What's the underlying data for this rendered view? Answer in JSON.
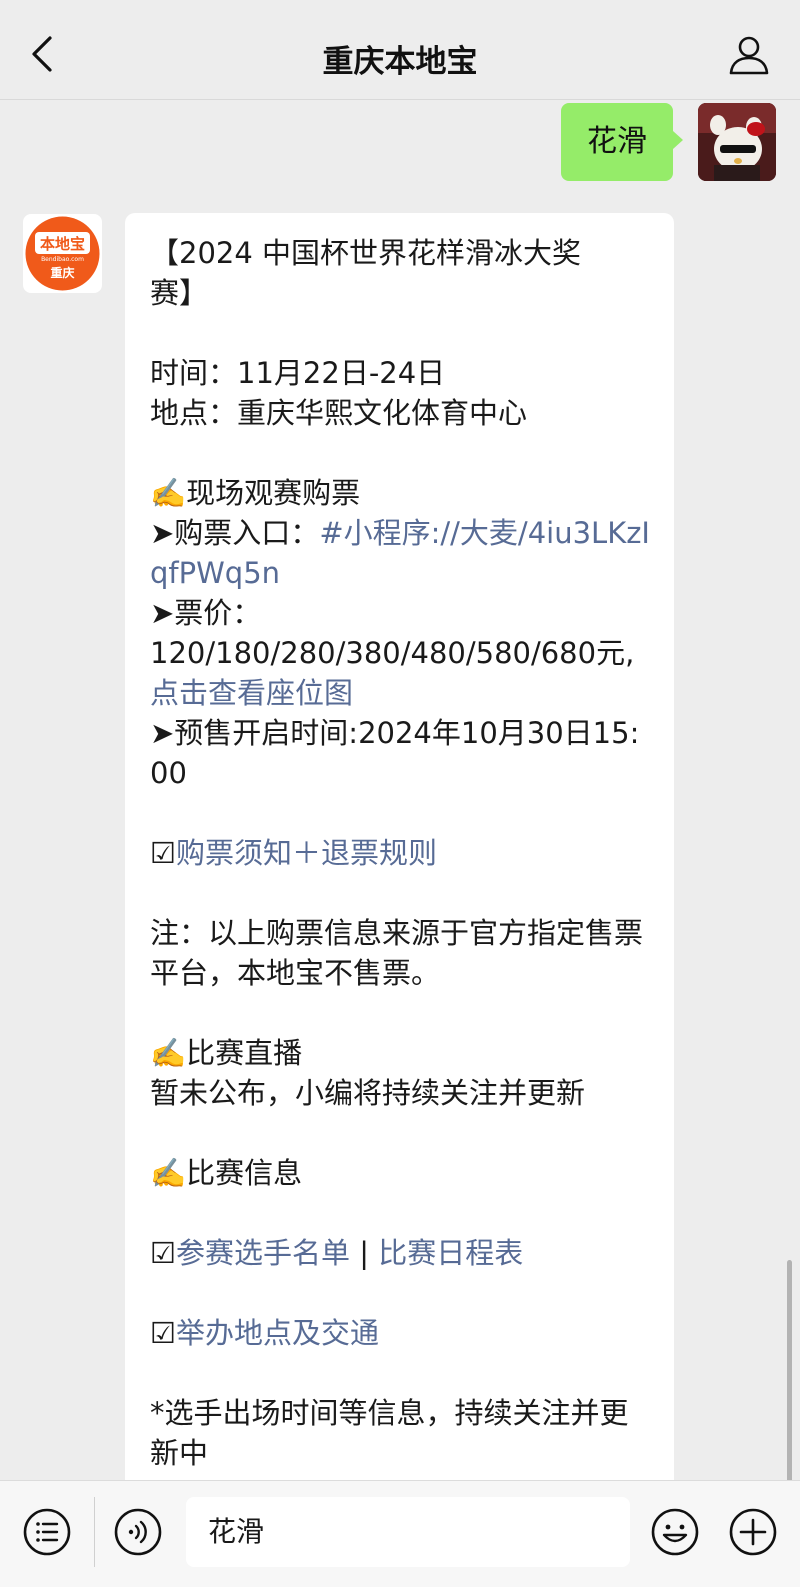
{
  "header": {
    "title": "重庆本地宝"
  },
  "my_message": {
    "text": "花滑"
  },
  "bot_avatar": {
    "top_text": "本地宝",
    "mid_text": "Bendibao.com",
    "bottom_text": "重庆"
  },
  "bot_message": {
    "title_line1": "【2024 中国杯世界花样滑冰大奖",
    "title_line2": "赛】",
    "time_label": "时间：",
    "time_value": "11月22日-24日",
    "place_label": "地点：",
    "place_value": "重庆华熙文化体育中心",
    "section1_title": "✍️现场观赛购票",
    "entry_prefix": "➤购票入口：",
    "entry_link": "#小程序://大麦/4iu3LKzIqfPWq5n",
    "price_label": "➤票价：",
    "price_value": "120/180/280/380/480/580/680元,",
    "price_link": "点击查看座位图",
    "presale_label": "➤预售开启时间:2024年10月30日15:00",
    "notice_check": "☑",
    "notice_link": "购票须知＋退票规则",
    "note": "注：以上购票信息来源于官方指定售票平台，本地宝不售票。",
    "section2_title": "✍️比赛直播",
    "section2_body": "暂未公布，小编将持续关注并更新",
    "section3_title": "✍️比赛信息",
    "info_check1": "☑",
    "info_link1": "参赛选手名单",
    "info_sep": " | ",
    "info_link2": "比赛日程表",
    "info_check2": "☑",
    "info_link3": "举办地点及交通",
    "footnote": "*选手出场时间等信息，持续关注并更新中"
  },
  "input_bar": {
    "value": "花滑"
  },
  "icons": {
    "back": "chevron-left-icon",
    "profile": "person-icon",
    "menu": "list-icon",
    "voice": "voice-icon",
    "emoji": "smiley-icon",
    "plus": "plus-icon"
  },
  "colors": {
    "my_bubble": "#95ec69",
    "link": "#576b95",
    "brand_orange": "#f05a1a"
  }
}
